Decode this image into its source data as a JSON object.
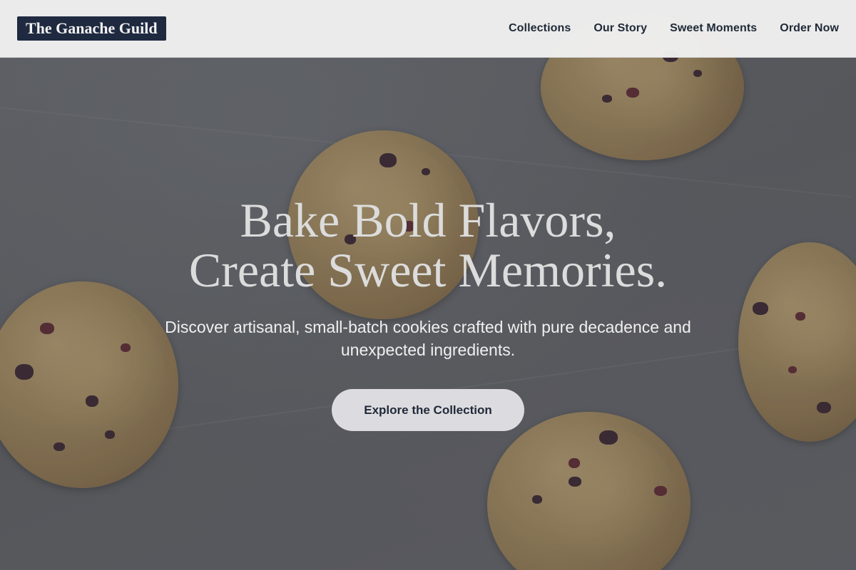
{
  "brand": {
    "logo_text": "The Ganache Guild"
  },
  "nav": {
    "items": [
      {
        "label": "Collections"
      },
      {
        "label": "Our Story"
      },
      {
        "label": "Sweet Moments"
      },
      {
        "label": "Order Now"
      }
    ]
  },
  "hero": {
    "headline_line1": "Bake Bold Flavors,",
    "headline_line2": "Create Sweet Memories.",
    "subtext": "Discover artisanal, small-batch cookies crafted with pure decadence and unexpected ingredients.",
    "cta_label": "Explore the Collection",
    "background_description_icon": "cookies-background-image"
  },
  "colors": {
    "header_bg": "#f0f0f0",
    "logo_bg": "#1f2a40",
    "nav_text": "#1f2937",
    "cta_bg": "#dcdbe0",
    "hero_overlay": "#5a5c60"
  }
}
